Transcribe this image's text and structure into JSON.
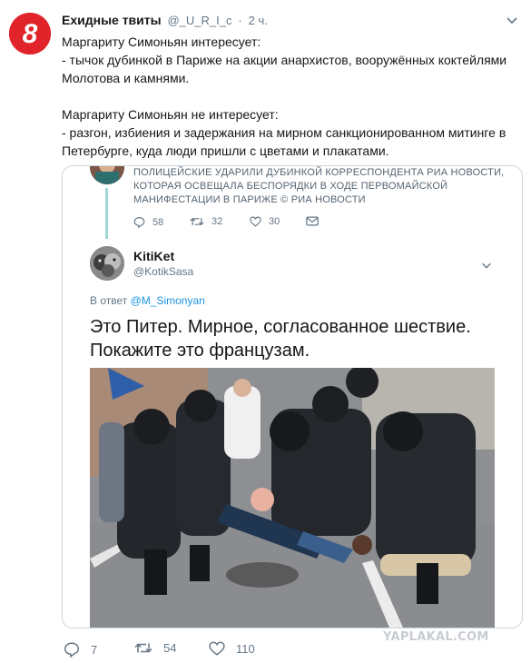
{
  "header": {
    "display_name": "Ехидные твиты",
    "handle": "@_U_R_I_c",
    "separator": "·",
    "time": "2 ч.",
    "avatar_icon": "eight-logo-icon",
    "avatar_color": "#e0242a"
  },
  "tweet": {
    "lines": [
      "Маргариту Симоньян интересует:",
      "- тычок дубинкой в Париже на акции анархистов, вооружённых коктейлями Молотова и камнями.",
      "",
      "Маргариту Симоньян не интересует:",
      "- разгон, избиения и задержания на мирном санкционированном митинге в Петербурге, куда люди пришли с цветами и плакатами."
    ]
  },
  "quoted": {
    "previous_tweet_text": "ПОЛИЦЕЙСКИЕ УДАРИЛИ ДУБИНКОЙ КОРРЕСПОНДЕНТА РИА НОВОСТИ, КОТОРАЯ ОСВЕЩАЛА БЕСПОРЯДКИ В ХОДЕ ПЕРВОМАЙСКОЙ МАНИФЕСТАЦИИ В ПАРИЖЕ © РИА Новости",
    "previous_stats": {
      "replies": "58",
      "retweets": "32",
      "likes": "30"
    },
    "author_name": "KitiKet",
    "author_handle": "@KotikSasa",
    "reply_prefix": "В ответ",
    "reply_handle": "@M_Simonyan",
    "text": "Это Питер. Мирное, согласованное шествие. Покажите это французам."
  },
  "stats": {
    "replies": "7",
    "retweets": "54",
    "likes": "110"
  },
  "watermark": "YAPLAKAL.COM",
  "colors": {
    "accent": "#1b95e0",
    "muted": "#657786",
    "thread_line": "#9fd8d7"
  }
}
